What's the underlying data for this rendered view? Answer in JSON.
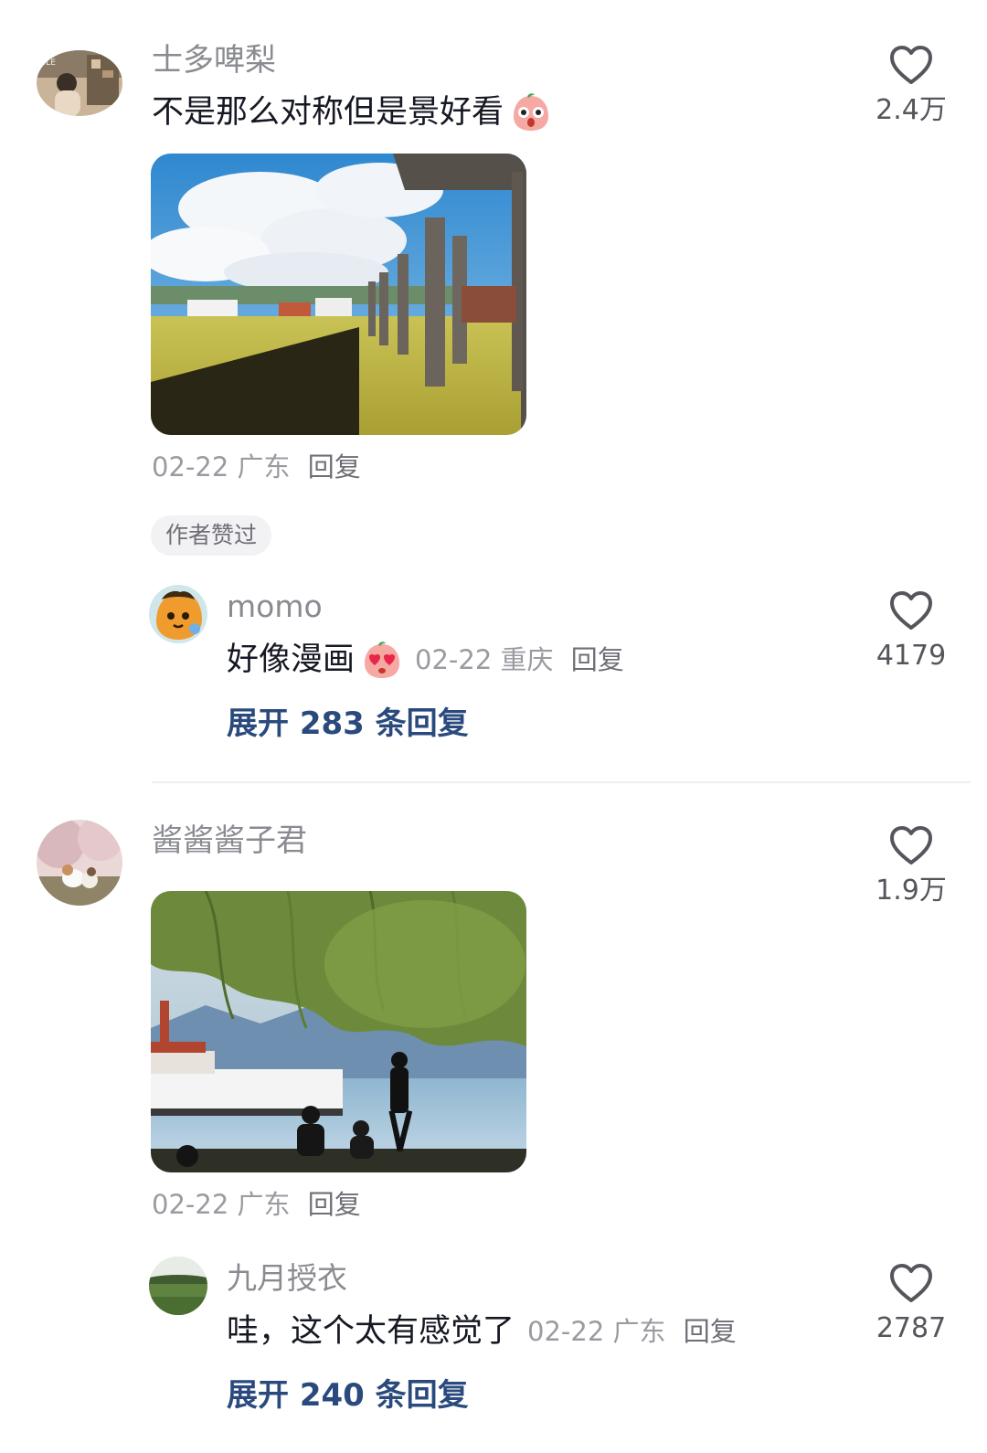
{
  "comments": [
    {
      "username": "士多啤梨",
      "text": "不是那么对称但是景好看",
      "date": "02-22",
      "location": "广东",
      "reply_label": "回复",
      "likes": "2.4万",
      "badge": "作者赞过",
      "sub_reply": {
        "username": "momo",
        "text": "好像漫画",
        "date": "02-22",
        "location": "重庆",
        "reply_label": "回复",
        "likes": "4179"
      },
      "expand_label": "展开 283 条回复"
    },
    {
      "username": "酱酱酱子君",
      "date": "02-22",
      "location": "广东",
      "reply_label": "回复",
      "likes": "1.9万",
      "sub_reply": {
        "username": "九月授衣",
        "text": "哇，这个太有感觉了",
        "date": "02-22",
        "location": "广东",
        "reply_label": "回复",
        "likes": "2787"
      },
      "expand_label": "展开 240 条回复"
    }
  ],
  "colors": {
    "username": "#8a8b91",
    "text": "#161823",
    "meta": "#9a9ba1",
    "expand": "#2a4a7d",
    "badge_bg": "#f2f2f4"
  },
  "icons": [
    "heart-outline-icon",
    "shocked-face-emoji",
    "love-face-emoji"
  ]
}
